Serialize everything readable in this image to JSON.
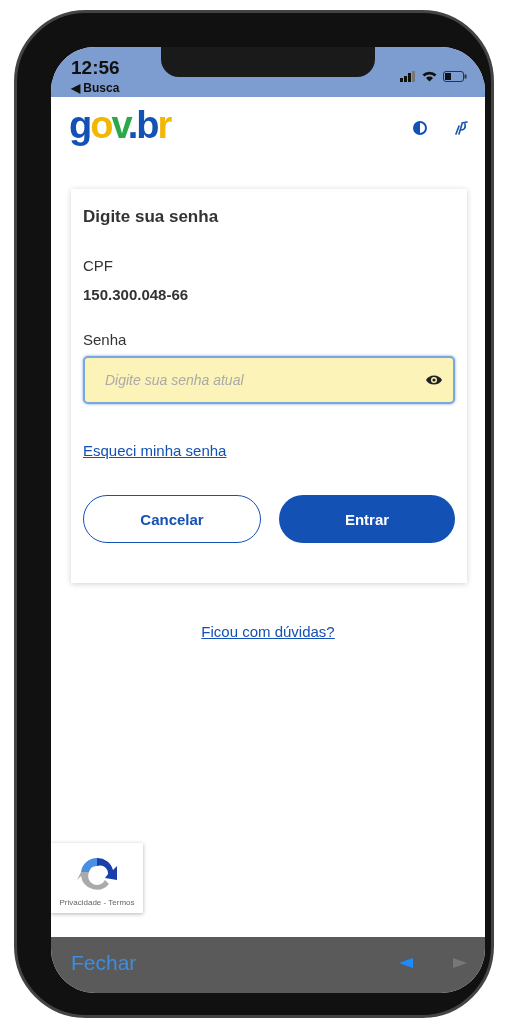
{
  "status_bar": {
    "time": "12:56",
    "back_label": "◀ Busca"
  },
  "header": {
    "logo": [
      {
        "text": "g",
        "color": "#1351b4"
      },
      {
        "text": "o",
        "color": "#f2b705"
      },
      {
        "text": "v",
        "color": "#2ba84a"
      },
      {
        "text": ".",
        "color": "#1351b4"
      },
      {
        "text": "b",
        "color": "#1351b4"
      },
      {
        "text": "r",
        "color": "#f2b705"
      }
    ]
  },
  "card": {
    "title": "Digite sua senha",
    "cpf_label": "CPF",
    "cpf_value": "150.300.048-66",
    "password_label": "Senha",
    "password_field": {
      "placeholder": "Digite sua senha atual",
      "focused": true
    },
    "forgot_link": "Esqueci minha senha",
    "buttons": [
      {
        "label": "Cancelar",
        "kind": "secondary"
      },
      {
        "label": "Entrar",
        "kind": "primary"
      }
    ]
  },
  "help_link": "Ficou com dúvidas?",
  "recaptcha": {
    "text": "Privacidade - Termos"
  },
  "toolbar": {
    "close": "Fechar",
    "back_disabled": false,
    "forward_disabled": true
  }
}
